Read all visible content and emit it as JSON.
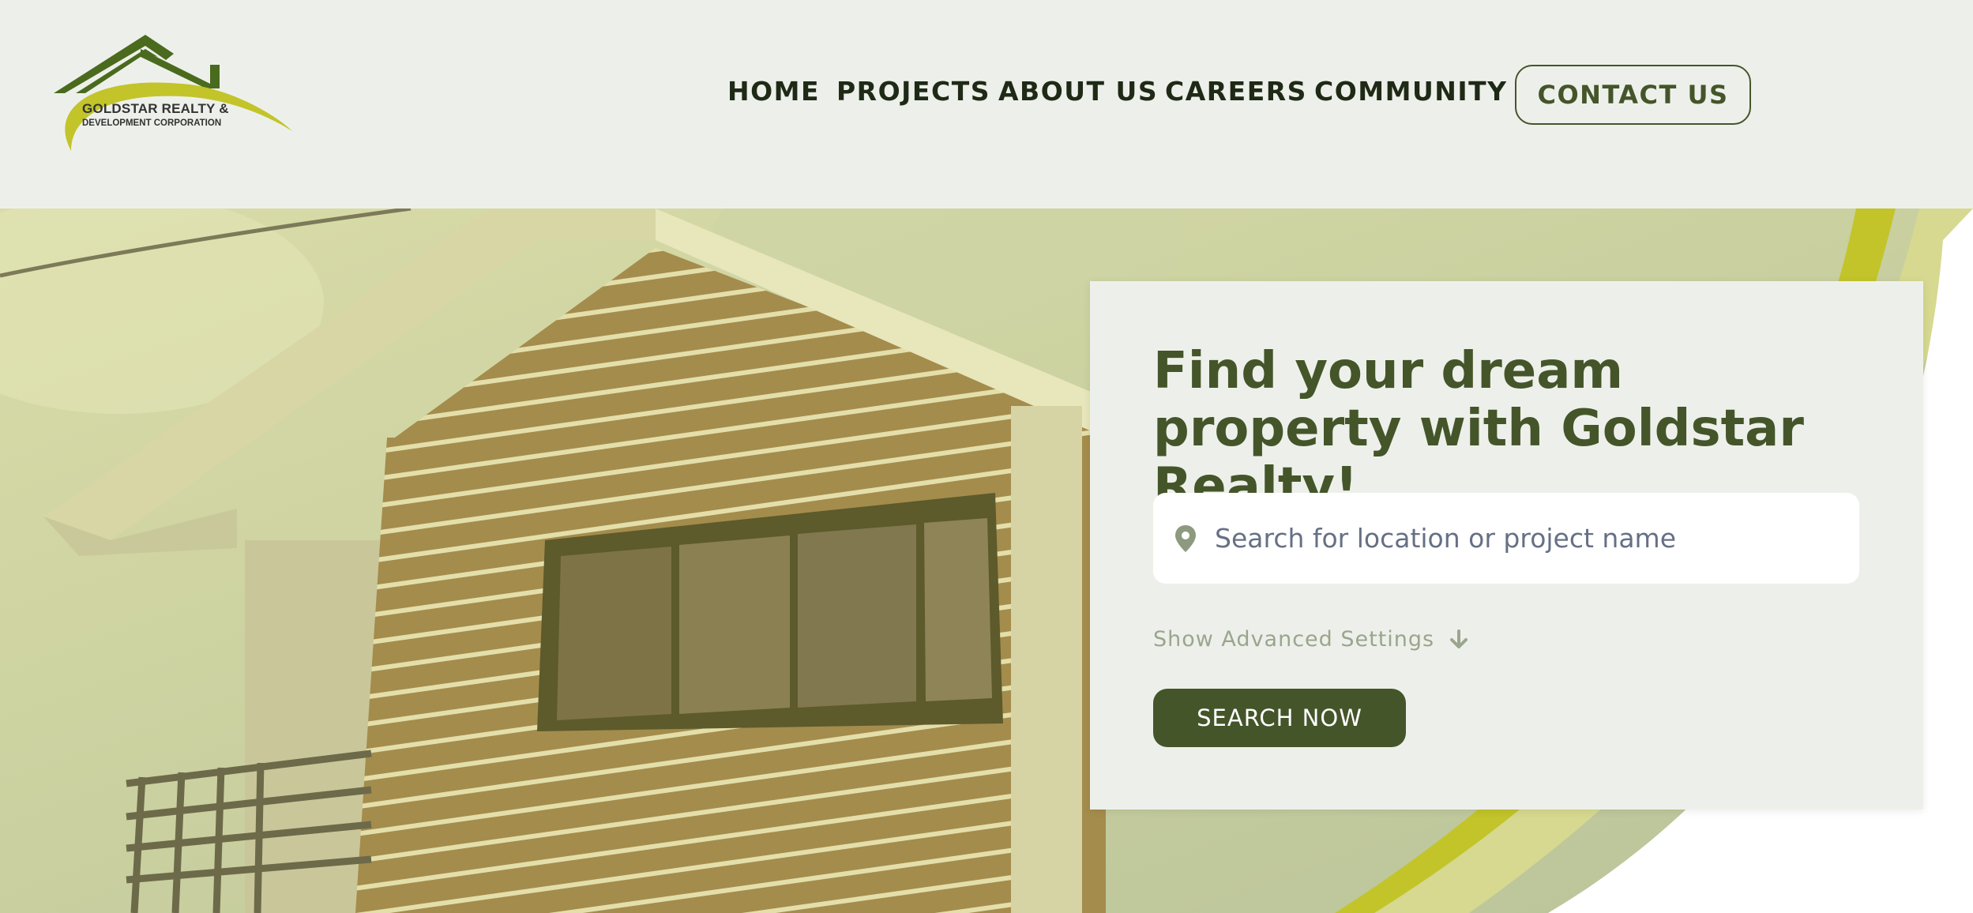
{
  "brand": {
    "line1": "GOLDSTAR REALTY &",
    "line2": "DEVELOPMENT CORPORATION"
  },
  "nav": {
    "items": [
      "HOME",
      "PROJECTS",
      "ABOUT US",
      "CAREERS",
      "COMMUNITY"
    ],
    "contact_label": "CONTACT US"
  },
  "hero": {
    "title": "Find your dream property with Goldstar Realty!",
    "search_placeholder": "Search for location or project name",
    "advanced_label": "Show Advanced Settings",
    "search_button": "SEARCH NOW"
  },
  "colors": {
    "primary": "#45552a",
    "accent": "#c2c42a",
    "background": "#edf0ea"
  },
  "icons": {
    "location": "map-pin-icon",
    "advanced": "arrow-down-icon"
  }
}
